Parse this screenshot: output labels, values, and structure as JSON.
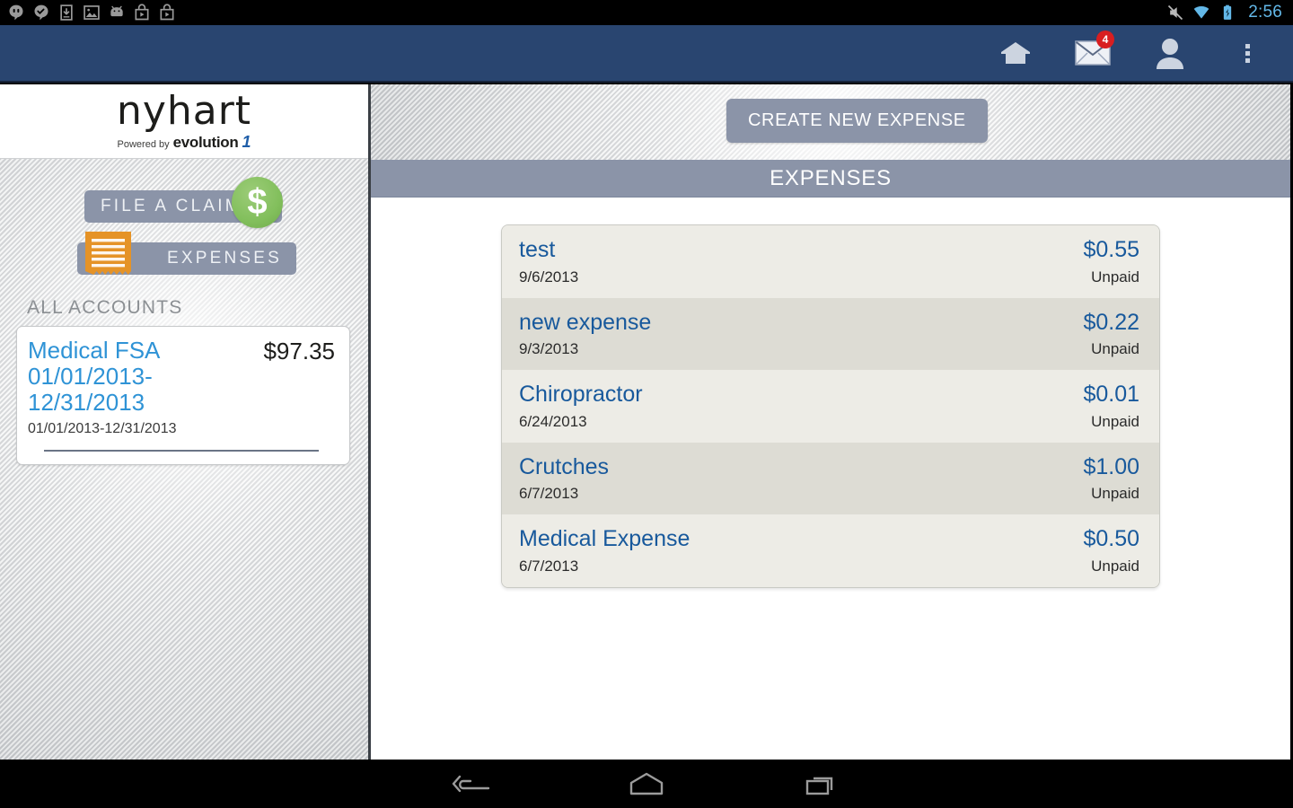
{
  "statusbar": {
    "time": "2:56",
    "left_icons": [
      "hangouts-icon",
      "chat-check-icon",
      "download-icon",
      "image-icon",
      "android-icon",
      "play-store-icon",
      "play-store-icon-2"
    ],
    "right_icons": [
      "mute-icon",
      "wifi-icon",
      "battery-charging-icon"
    ]
  },
  "actionbar": {
    "home_icon": "home-icon",
    "mail_icon": "mail-icon",
    "mail_badge": "4",
    "profile_icon": "person-icon",
    "overflow_icon": "overflow-menu-icon"
  },
  "sidebar": {
    "logo": {
      "word": "nyhart",
      "powered_by": "Powered by",
      "brand": "evolution",
      "brand_mark": "1"
    },
    "nav": [
      {
        "label": "FILE A CLAIM",
        "icon": "dollar-coin-icon",
        "glyph": "$"
      },
      {
        "label": "EXPENSES",
        "icon": "receipt-icon"
      }
    ],
    "accounts_label": "ALL ACCOUNTS",
    "account": {
      "name": "Medical FSA 01/01/2013-12/31/2013",
      "amount": "$97.35",
      "dates": "01/01/2013-12/31/2013"
    }
  },
  "content": {
    "create_button": "CREATE NEW EXPENSE",
    "section_title": "EXPENSES",
    "expenses": [
      {
        "title": "test",
        "date": "9/6/2013",
        "amount": "$0.55",
        "status": "Unpaid"
      },
      {
        "title": "new expense",
        "date": "9/3/2013",
        "amount": "$0.22",
        "status": "Unpaid"
      },
      {
        "title": "Chiropractor",
        "date": "6/24/2013",
        "amount": "$0.01",
        "status": "Unpaid"
      },
      {
        "title": "Crutches",
        "date": "6/7/2013",
        "amount": "$1.00",
        "status": "Unpaid"
      },
      {
        "title": "Medical Expense",
        "date": "6/7/2013",
        "amount": "$0.50",
        "status": "Unpaid"
      }
    ]
  },
  "navbar": {
    "back": "back-icon",
    "home": "home-icon",
    "recents": "recent-apps-icon"
  },
  "colors": {
    "actionbar": "#294570",
    "accent_pill": "#8b94a8",
    "link_blue": "#18599c",
    "account_blue": "#2f93d6",
    "coin_green": "#82bf5c",
    "receipt_orange": "#e59327",
    "badge_red": "#d81e20",
    "status_time": "#63b8e8"
  }
}
